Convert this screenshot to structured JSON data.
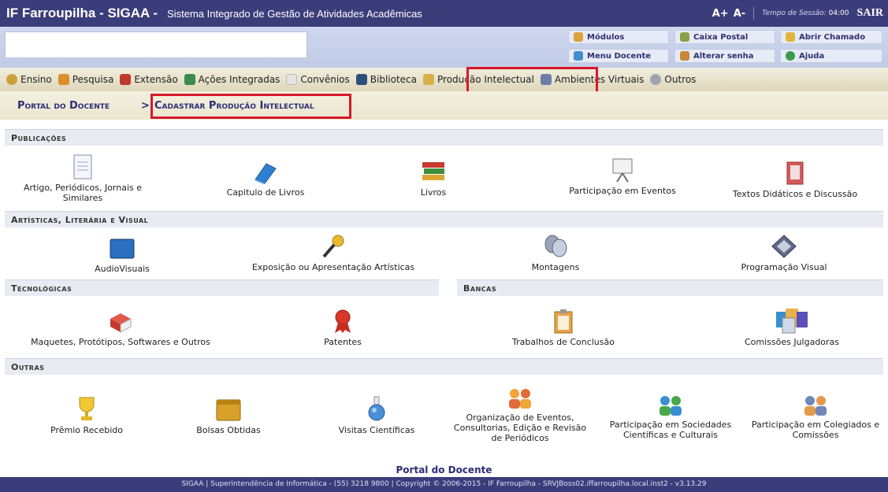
{
  "header": {
    "brand": "IF Farroupilha - SIGAA -",
    "system_name": "Sistema Integrado de Gestão de Atividades Acadêmicas",
    "font_increase": "A+",
    "font_decrease": "A-",
    "session_label": "Tempo de Sessão:",
    "session_time": "04:00",
    "logout": "SAIR"
  },
  "quick_links": {
    "modulos": "Módulos",
    "caixa_postal": "Caixa Postal",
    "abrir_chamado": "Abrir Chamado",
    "menu_docente": "Menu Docente",
    "alterar_senha": "Alterar senha",
    "ajuda": "Ajuda"
  },
  "menu": [
    {
      "label": "Ensino",
      "icon": "globe-icon",
      "color": "#c9a23a"
    },
    {
      "label": "Pesquisa",
      "icon": "flask-icon",
      "color": "#d9902a"
    },
    {
      "label": "Extensão",
      "icon": "heart-icon",
      "color": "#c0392b"
    },
    {
      "label": "Ações Integradas",
      "icon": "people-icon",
      "color": "#3a8c4a"
    },
    {
      "label": "Convênios",
      "icon": "document-icon",
      "color": "#d8d8d8"
    },
    {
      "label": "Biblioteca",
      "icon": "library-icon",
      "color": "#2d4f7a"
    },
    {
      "label": "Produção Intelectual",
      "icon": "book-icon",
      "color": "#d8b04a"
    },
    {
      "label": "Ambientes Virtuais",
      "icon": "network-icon",
      "color": "#6c7fa8"
    },
    {
      "label": "Outros",
      "icon": "other-icon",
      "color": "#9ea4b0"
    }
  ],
  "breadcrumb": {
    "root": "Portal do Docente",
    "separator": ">",
    "current": "Cadastrar Produção Intelectual"
  },
  "sections": {
    "publicacoes": "Publicações",
    "artisticas": "Artísticas, Literária e Visual",
    "tecnologicas": "Tecnológicas",
    "bancas": "Bancas",
    "outras": "Outras"
  },
  "items": {
    "artigo": "Artigo, Periódicos, Jornais e Similares",
    "capitulo": "Capitulo de Livros",
    "livros": "Livros",
    "participacao_eventos": "Participação em Eventos",
    "textos_didaticos": "Textos Didáticos e Discussão",
    "audiovisuais": "AudioVisuais",
    "exposicao": "Exposição ou Apresentação Artísticas",
    "montagens": "Montagens",
    "programacao_visual": "Programação Visual",
    "maquetes": "Maquetes, Protótipos, Softwares e Outros",
    "patentes": "Patentes",
    "trabalhos_conclusao": "Trabalhos de Conclusão",
    "comissoes": "Comissões Julgadoras",
    "premio": "Prêmio Recebido",
    "bolsas": "Bolsas Obtidas",
    "visitas": "Visitas Científicas",
    "organizacao": "Organização de Eventos, Consultorias, Edição e Revisão de Periódicos",
    "sociedades": "Participação em Sociedades Científicas e Culturais",
    "colegiados": "Participação em Colegiados e Comissões"
  },
  "footer": {
    "link": "Portal do Docente",
    "text": "SIGAA | Superintendência de Informática - (55) 3218 9800 | Copyright © 2006-2015 - IF Farroupilha - SRVJBoss02.iffarroupilha.local.inst2 - v3.13.29"
  }
}
